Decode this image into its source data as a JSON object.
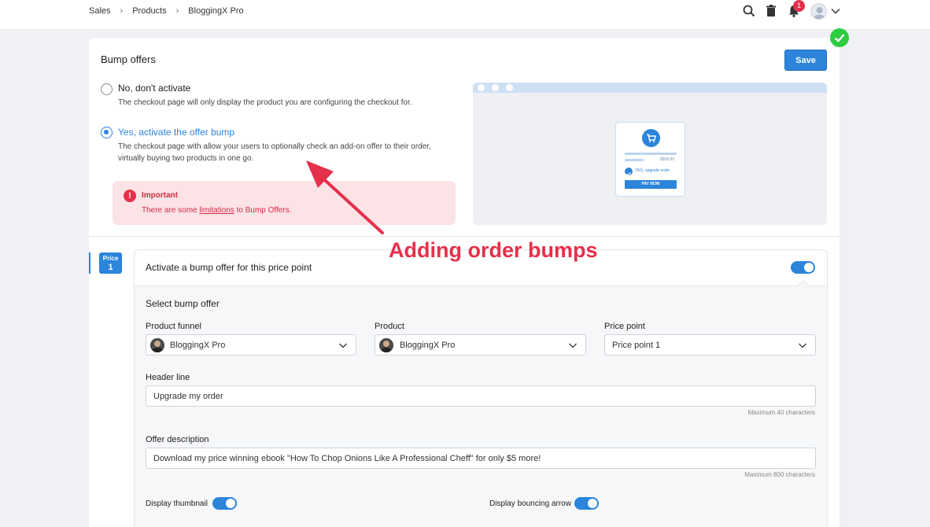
{
  "breadcrumb": [
    "Sales",
    "Products",
    "BloggingX Pro"
  ],
  "header": {
    "notification_count": "1"
  },
  "bump": {
    "title": "Bump offers",
    "save_label": "Save",
    "option_no_title": "No, don't activate",
    "option_no_desc": "The checkout page will only display the product you are configuring the checkout for.",
    "option_yes_title": "Yes, activate the offer bump",
    "option_yes_desc_1": "The checkout page with allow your users to optionally check an add-on offer to their order,",
    "option_yes_desc_2": "virtually buying two products in one go.",
    "alert_title": "Important",
    "alert_prefix": "There are some ",
    "alert_link": "limitations",
    "alert_suffix": " to Bump Offers."
  },
  "preview": {
    "price": "$999.99",
    "upgrade": "YES, upgrade order",
    "pay": "PAY NOW"
  },
  "annotation": "Adding order bumps",
  "price_tab": {
    "label": "Price",
    "number": "1"
  },
  "form": {
    "activate_title": "Activate a bump offer for this price point",
    "select_title": "Select bump offer",
    "funnel_label": "Product funnel",
    "funnel_value": "BloggingX Pro",
    "product_label": "Product",
    "product_value": "BloggingX Pro",
    "price_label": "Price point",
    "price_value": "Price point 1",
    "header_label": "Header line",
    "header_value": "Upgrade my order",
    "header_hint": "Maximum 40 characters",
    "desc_label": "Offer description",
    "desc_value": "Download my price winning ebook \"How To Chop Onions Like A Professional Cheff\" for only $5 more!",
    "desc_hint": "Maximum 800 characters",
    "thumb_label": "Display thumbnail",
    "arrow_label": "Display bouncing arrow"
  },
  "colors": {
    "accent": "#2c84db",
    "danger": "#e5304a",
    "success": "#2ecc40"
  }
}
